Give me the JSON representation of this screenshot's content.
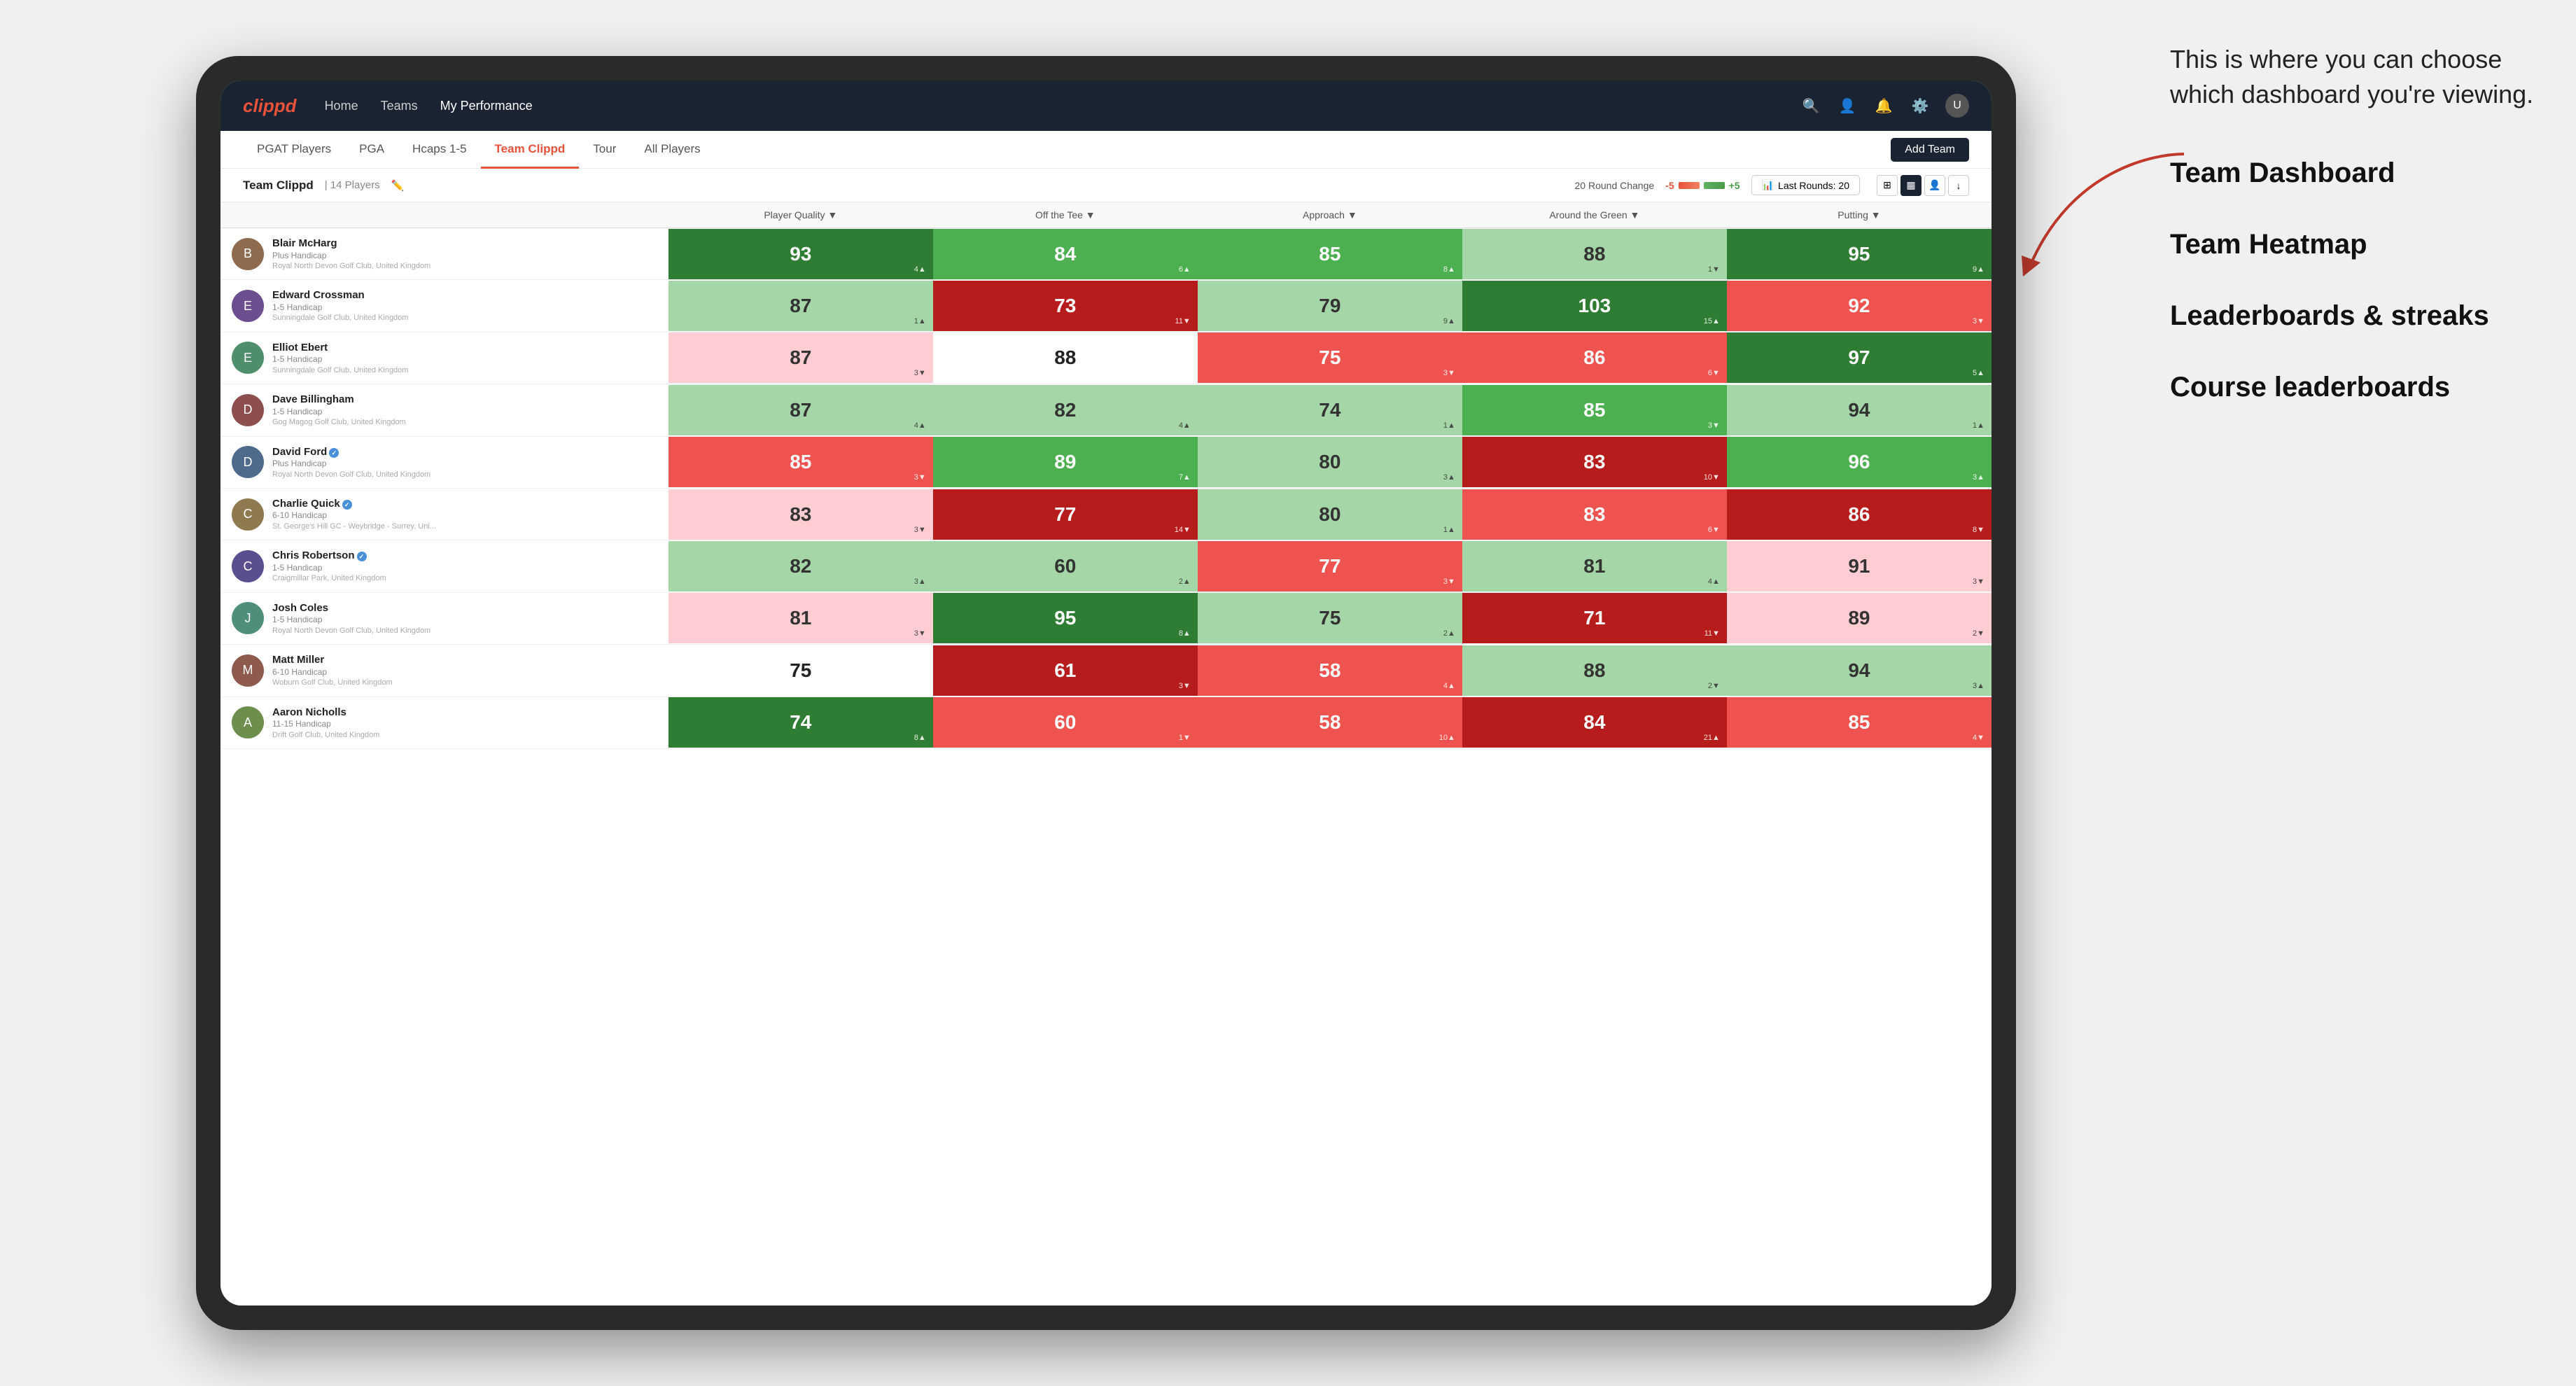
{
  "annotation": {
    "bubble_text": "This is where you can choose which dashboard you're viewing.",
    "items": [
      {
        "label": "Team Dashboard"
      },
      {
        "label": "Team Heatmap"
      },
      {
        "label": "Leaderboards & streaks"
      },
      {
        "label": "Course leaderboards"
      }
    ]
  },
  "navbar": {
    "logo": "clippd",
    "items": [
      "Home",
      "Teams",
      "My Performance"
    ],
    "icons": [
      "search",
      "person",
      "bell",
      "settings",
      "account"
    ]
  },
  "subnav": {
    "items": [
      "PGAT Players",
      "PGA",
      "Hcaps 1-5",
      "Team Clippd",
      "Tour",
      "All Players"
    ],
    "active": "Team Clippd",
    "add_button": "Add Team"
  },
  "team_bar": {
    "name": "Team Clippd",
    "separator": "|",
    "count": "14 Players",
    "round_change_label": "20 Round Change",
    "change_neg": "-5",
    "change_pos": "+5",
    "last_rounds_label": "Last Rounds:",
    "last_rounds_value": "20"
  },
  "table": {
    "headers": [
      "Player Quality ▼",
      "Off the Tee ▼",
      "Approach ▼",
      "Around the Green ▼",
      "Putting ▼"
    ],
    "players": [
      {
        "name": "Blair McHarg",
        "handicap": "Plus Handicap",
        "club": "Royal North Devon Golf Club, United Kingdom",
        "verified": false,
        "scores": [
          {
            "value": 93,
            "change": "4",
            "dir": "up",
            "color": "dark-green"
          },
          {
            "value": 84,
            "change": "6",
            "dir": "up",
            "color": "medium-green"
          },
          {
            "value": 85,
            "change": "8",
            "dir": "up",
            "color": "medium-green"
          },
          {
            "value": 88,
            "change": "1",
            "dir": "down",
            "color": "light-green"
          },
          {
            "value": 95,
            "change": "9",
            "dir": "up",
            "color": "dark-green"
          }
        ]
      },
      {
        "name": "Edward Crossman",
        "handicap": "1-5 Handicap",
        "club": "Sunningdale Golf Club, United Kingdom",
        "verified": false,
        "scores": [
          {
            "value": 87,
            "change": "1",
            "dir": "up",
            "color": "light-green"
          },
          {
            "value": 73,
            "change": "11",
            "dir": "down",
            "color": "dark-red"
          },
          {
            "value": 79,
            "change": "9",
            "dir": "up",
            "color": "light-green"
          },
          {
            "value": 103,
            "change": "15",
            "dir": "up",
            "color": "dark-green"
          },
          {
            "value": 92,
            "change": "3",
            "dir": "down",
            "color": "medium-red"
          }
        ]
      },
      {
        "name": "Elliot Ebert",
        "handicap": "1-5 Handicap",
        "club": "Sunningdale Golf Club, United Kingdom",
        "verified": false,
        "scores": [
          {
            "value": 87,
            "change": "3",
            "dir": "down",
            "color": "light-red"
          },
          {
            "value": 88,
            "change": "",
            "dir": "",
            "color": "white-bg"
          },
          {
            "value": 75,
            "change": "3",
            "dir": "down",
            "color": "medium-red"
          },
          {
            "value": 86,
            "change": "6",
            "dir": "down",
            "color": "medium-red"
          },
          {
            "value": 97,
            "change": "5",
            "dir": "up",
            "color": "dark-green"
          }
        ]
      },
      {
        "name": "Dave Billingham",
        "handicap": "1-5 Handicap",
        "club": "Gog Magog Golf Club, United Kingdom",
        "verified": false,
        "scores": [
          {
            "value": 87,
            "change": "4",
            "dir": "up",
            "color": "light-green"
          },
          {
            "value": 82,
            "change": "4",
            "dir": "up",
            "color": "light-green"
          },
          {
            "value": 74,
            "change": "1",
            "dir": "up",
            "color": "light-green"
          },
          {
            "value": 85,
            "change": "3",
            "dir": "down",
            "color": "medium-green"
          },
          {
            "value": 94,
            "change": "1",
            "dir": "up",
            "color": "light-green"
          }
        ]
      },
      {
        "name": "David Ford",
        "handicap": "Plus Handicap",
        "club": "Royal North Devon Golf Club, United Kingdom",
        "verified": true,
        "scores": [
          {
            "value": 85,
            "change": "3",
            "dir": "down",
            "color": "medium-red"
          },
          {
            "value": 89,
            "change": "7",
            "dir": "up",
            "color": "medium-green"
          },
          {
            "value": 80,
            "change": "3",
            "dir": "up",
            "color": "light-green"
          },
          {
            "value": 83,
            "change": "10",
            "dir": "down",
            "color": "dark-red"
          },
          {
            "value": 96,
            "change": "3",
            "dir": "up",
            "color": "medium-green"
          }
        ]
      },
      {
        "name": "Charlie Quick",
        "handicap": "6-10 Handicap",
        "club": "St. George's Hill GC - Weybridge - Surrey, Uni...",
        "verified": true,
        "scores": [
          {
            "value": 83,
            "change": "3",
            "dir": "down",
            "color": "light-red"
          },
          {
            "value": 77,
            "change": "14",
            "dir": "down",
            "color": "dark-red"
          },
          {
            "value": 80,
            "change": "1",
            "dir": "up",
            "color": "light-green"
          },
          {
            "value": 83,
            "change": "6",
            "dir": "down",
            "color": "medium-red"
          },
          {
            "value": 86,
            "change": "8",
            "dir": "down",
            "color": "dark-red"
          }
        ]
      },
      {
        "name": "Chris Robertson",
        "handicap": "1-5 Handicap",
        "club": "Craigmillar Park, United Kingdom",
        "verified": true,
        "scores": [
          {
            "value": 82,
            "change": "3",
            "dir": "up",
            "color": "light-green"
          },
          {
            "value": 60,
            "change": "2",
            "dir": "up",
            "color": "light-green"
          },
          {
            "value": 77,
            "change": "3",
            "dir": "down",
            "color": "medium-red"
          },
          {
            "value": 81,
            "change": "4",
            "dir": "up",
            "color": "light-green"
          },
          {
            "value": 91,
            "change": "3",
            "dir": "down",
            "color": "light-red"
          }
        ]
      },
      {
        "name": "Josh Coles",
        "handicap": "1-5 Handicap",
        "club": "Royal North Devon Golf Club, United Kingdom",
        "verified": false,
        "scores": [
          {
            "value": 81,
            "change": "3",
            "dir": "down",
            "color": "light-red"
          },
          {
            "value": 95,
            "change": "8",
            "dir": "up",
            "color": "dark-green"
          },
          {
            "value": 75,
            "change": "2",
            "dir": "up",
            "color": "light-green"
          },
          {
            "value": 71,
            "change": "11",
            "dir": "down",
            "color": "dark-red"
          },
          {
            "value": 89,
            "change": "2",
            "dir": "down",
            "color": "light-red"
          }
        ]
      },
      {
        "name": "Matt Miller",
        "handicap": "6-10 Handicap",
        "club": "Woburn Golf Club, United Kingdom",
        "verified": false,
        "scores": [
          {
            "value": 75,
            "change": "",
            "dir": "",
            "color": "white-bg"
          },
          {
            "value": 61,
            "change": "3",
            "dir": "down",
            "color": "dark-red"
          },
          {
            "value": 58,
            "change": "4",
            "dir": "up",
            "color": "medium-red"
          },
          {
            "value": 88,
            "change": "2",
            "dir": "down",
            "color": "light-green"
          },
          {
            "value": 94,
            "change": "3",
            "dir": "up",
            "color": "light-green"
          }
        ]
      },
      {
        "name": "Aaron Nicholls",
        "handicap": "11-15 Handicap",
        "club": "Drift Golf Club, United Kingdom",
        "verified": false,
        "scores": [
          {
            "value": 74,
            "change": "8",
            "dir": "up",
            "color": "dark-green"
          },
          {
            "value": 60,
            "change": "1",
            "dir": "down",
            "color": "medium-red"
          },
          {
            "value": 58,
            "change": "10",
            "dir": "up",
            "color": "medium-red"
          },
          {
            "value": 84,
            "change": "21",
            "dir": "up",
            "color": "dark-red"
          },
          {
            "value": 85,
            "change": "4",
            "dir": "down",
            "color": "medium-red"
          }
        ]
      }
    ]
  }
}
